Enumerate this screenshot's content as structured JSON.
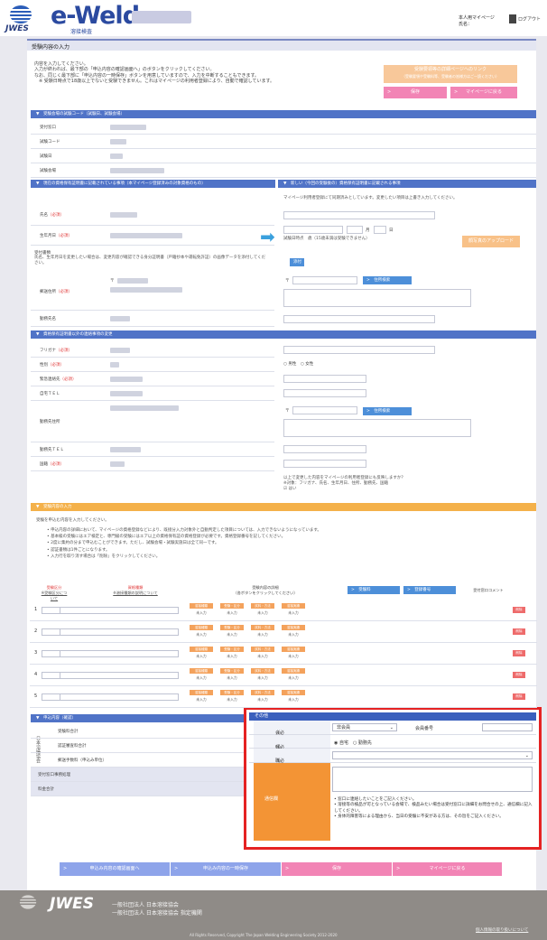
{
  "header": {
    "logo_org": "JWES",
    "logo_title": "e-Weld",
    "logo_subtitle": "溶接検査",
    "my_page_label": "本人用マイページ",
    "user_label": "氏名：",
    "logout_label": "ログアウト"
  },
  "page_title": "受験内容の入力",
  "intro": {
    "line1": "内容を入力してください。",
    "line2": "入力が終われば、最下部の「申込内容の確認画面へ」のボタンをクリックしてください。",
    "line3": "なお、同じく最下部に「申込内容の一時保存」ボタンを用意していますので、入力を中断することもできます。",
    "line4": "※ 受験日時点で18歳以上でないと受験できません。これはマイページの利用者登録により、自動で確認しています。",
    "link_title": "受験要領等の詳細ページへのリンク",
    "link_sub": "（受験要領や受験料等、受験者の皆様方はご一読ください）",
    "btn_save": "保存",
    "btn_mypage": "マイページに戻る"
  },
  "sections": {
    "exam_code": "受験会場の試験コード（試験日、試験会場）",
    "left_current": "現在の資格保有証明書に記載されている事項（本マイページ登録済みの対象資格のもの）",
    "right_new": "新しい（今回の受験後の）資格保有証明書に記載される事項",
    "contact": "資格保有証明書以外の連絡事項の変更",
    "apply": "受験内容の入力",
    "fees": "申込内容（確認）",
    "other": "その他"
  },
  "exam_info": {
    "rows": [
      "受付窓口",
      "試験コード",
      "試験日",
      "試験会場"
    ]
  },
  "cert": {
    "name_label": "氏名",
    "dob_label": "生年月日",
    "photo_label": "受付書類",
    "photo_note": "氏名、生年月日を変更したい場合は、変更内容が確認できる身分証明書（戸籍抄本や運転免許証）の画像データを添付してください。",
    "address_label": "郵送住所",
    "office_label": "勤務先名",
    "right_note": "マイページ利用者登録にて同期済みとしています。変更したい項目は上書き入力してください。",
    "dob_month": "月",
    "dob_day": "日",
    "age_note": "試験日時点　歳（15歳未満は受験できません）",
    "photo_upload_btn": "顔写真のアップロード",
    "attach_btn": "添付",
    "address_search_btn": "住所検索",
    "required": "（必須）"
  },
  "contact": {
    "rows": [
      "フリガナ",
      "性別",
      "緊急連絡先",
      "自宅ＴＥＬ",
      "勤務先住所",
      "勤務先ＴＥＬ",
      "国籍"
    ],
    "required_rows": [
      true,
      true,
      true,
      false,
      false,
      false,
      true
    ],
    "gender_male": "男性",
    "gender_female": "女性",
    "address_search_btn": "住所検索",
    "mypage_note_1": "以上で変更した内容をマイページの利用者登録にも反映しますか？",
    "mypage_note_2": "※対象：フリガナ、氏名、生年月日、住所、勤務先、国籍",
    "mypage_check": "はい"
  },
  "apply": {
    "intro": "受験を申込む内容を入力してください。",
    "items": [
      "申込内容の詳細において、マイページの資格登録などにより、既接分入力対象外と自動判定した項目については、入力できないようになっています。",
      "基本級の受験にはエア検定と、専門級の受験にはエア以上の資格保有証の資格登録が必要です。資格登録番号を記してください。",
      "2度に集約の分まで申込むことができます。ただし、試験会場・試験実施日は全て同一です。",
      "認証書類は1件ごとになります。",
      "入力行を取り消す場合は「削除」をクリックしてください。"
    ],
    "col_kind": "受験区分",
    "col_kind_sub": "※受験区分について",
    "col_cert": "資格種類",
    "col_cert_sub": "※溶接種類の説明について",
    "col_detail": "受験内容の詳細",
    "col_detail_sub": "（各ボタンをクリックしてください）",
    "col_file": "受験料",
    "col_reg": "登録番号",
    "col_comment": "受付窓口コメント",
    "detail_btns": [
      "溶接種類",
      "受験・区分",
      "試料・方法",
      "溶接実績"
    ],
    "detail_status": "未入力",
    "delete_btn": "削除",
    "row_numbers": [
      "1",
      "2",
      "3",
      "4",
      "5"
    ]
  },
  "fees": {
    "vertical": "日本溶接協会",
    "rows": [
      "受験料合計",
      "認証審査料合計",
      "郵送手数料（申込み単位）",
      "受付窓口事務処理",
      "料金合計"
    ]
  },
  "other": {
    "member_label": "会員／非会員区分",
    "member_value": "非会員",
    "member_no_label": "会員番号",
    "mail_label": "郵送先",
    "mail_home": "自宅",
    "mail_office": "勤務先",
    "nationality_label": "職種",
    "remarks_label": "通信欄",
    "notes": [
      "窓口に連絡したいことをご記入ください。",
      "溶接等の検品が可となっている会場で、検品みたい場合は受付窓口に詳細をお問合せの上、通信欄に記入してください。",
      "身体的障害等による理由から、当日の受験に不安がある方は、その旨をご記入ください。"
    ],
    "required": "（必須）"
  },
  "bottom": {
    "btn_confirm": "申込み内容の確認画面へ",
    "btn_temp": "申込み内容の一時保存",
    "btn_save": "保存",
    "btn_mypage": "マイページに戻る"
  },
  "footer": {
    "org": "JWES",
    "line1": "一般社団法人 日本溶接協会",
    "line2": "一般社団法人 日本溶接協会 指定機関",
    "privacy": "個人情報の取り扱いについて",
    "copyright": "All Rights Reserved, Copyright The Japan Welding Engineering Society 2012-2020"
  },
  "colors": {
    "primary": "#5073c7",
    "accent_orange": "#f39435",
    "pink": "#f284b5",
    "highlight": "#e52222"
  }
}
